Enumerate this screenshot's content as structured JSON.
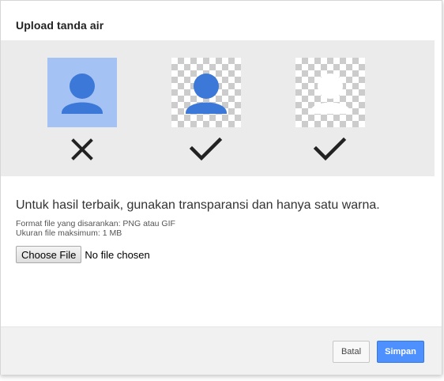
{
  "dialog": {
    "title": "Upload tanda air"
  },
  "examples": [
    {
      "style": "solid-background",
      "result": "invalid",
      "icon": "close-icon",
      "person_color": "#3c78d8",
      "background": "#a4c2f4"
    },
    {
      "style": "transparent-colored",
      "result": "valid",
      "icon": "check-icon",
      "person_color": "#3c78d8"
    },
    {
      "style": "transparent-white",
      "result": "valid",
      "icon": "check-icon",
      "person_color": "#ffffff"
    }
  ],
  "guidance": {
    "hint": "Untuk hasil terbaik, gunakan transparansi dan hanya satu warna.",
    "format": "Format file yang disarankan: PNG atau GIF",
    "max_size": "Ukuran file maksimum: 1 MB"
  },
  "file_input": {
    "button_label": "Choose File",
    "status": "No file chosen"
  },
  "footer": {
    "cancel_label": "Batal",
    "save_label": "Simpan"
  },
  "colors": {
    "accent": "#4d90fe",
    "mark": "#222222"
  }
}
